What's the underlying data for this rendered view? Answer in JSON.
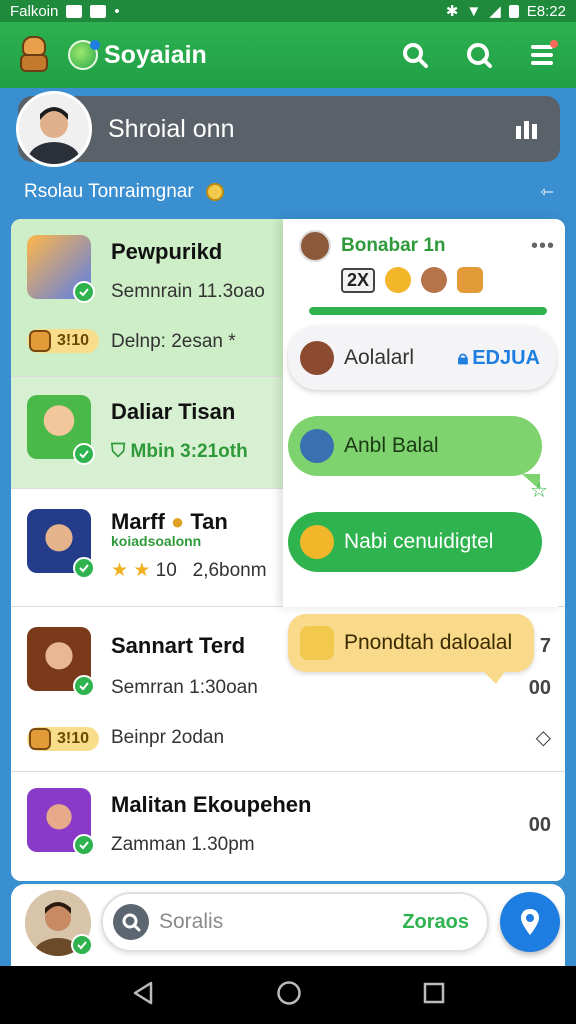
{
  "status_bar": {
    "carrier": "Falkoin",
    "time": "E8:22"
  },
  "app_bar": {
    "title": "Soyaiain"
  },
  "profile": {
    "label": "Shroial onn"
  },
  "subline": {
    "text": "Rsolau Tonraimgnar"
  },
  "list": [
    {
      "name": "Pewpurikd",
      "meta": "Semnrain 11.3oao",
      "pill": "3!10",
      "pill_caption": "Delnp: 2esan *"
    },
    {
      "name": "Daliar Tisan",
      "meta": "Mbin 3:21oth"
    },
    {
      "name": "Marff",
      "name_suffix": "Tan",
      "subtitle": "koiadsoalonn",
      "rating": "10",
      "meta": "2,6bonm"
    },
    {
      "name": "Sannart Terd",
      "meta": "Semrran 1:30oan",
      "pill": "3!10",
      "pill_caption": "Beinpr 2odan",
      "side_top": "7",
      "side_mid": "00"
    },
    {
      "name": "Malitan Ekoupehen",
      "meta": "Zamman 1.30pm",
      "side_mid": "00"
    }
  ],
  "overlay": {
    "title": "Bonabar 1n",
    "sticker_text": "2X",
    "progress": 1.0,
    "bubbles": [
      {
        "text": "Aolalarl",
        "tag": "EDJUA"
      },
      {
        "text": "Anbl Balal"
      },
      {
        "text": "Nabi cenuidigtel"
      },
      {
        "text": "Pnondtah daloalal"
      }
    ]
  },
  "search": {
    "placeholder": "Soralis",
    "action": "Zoraos"
  },
  "colors": {
    "primary": "#2fb34e",
    "accent": "#1e7de0",
    "pill": "#f8dd8a"
  }
}
